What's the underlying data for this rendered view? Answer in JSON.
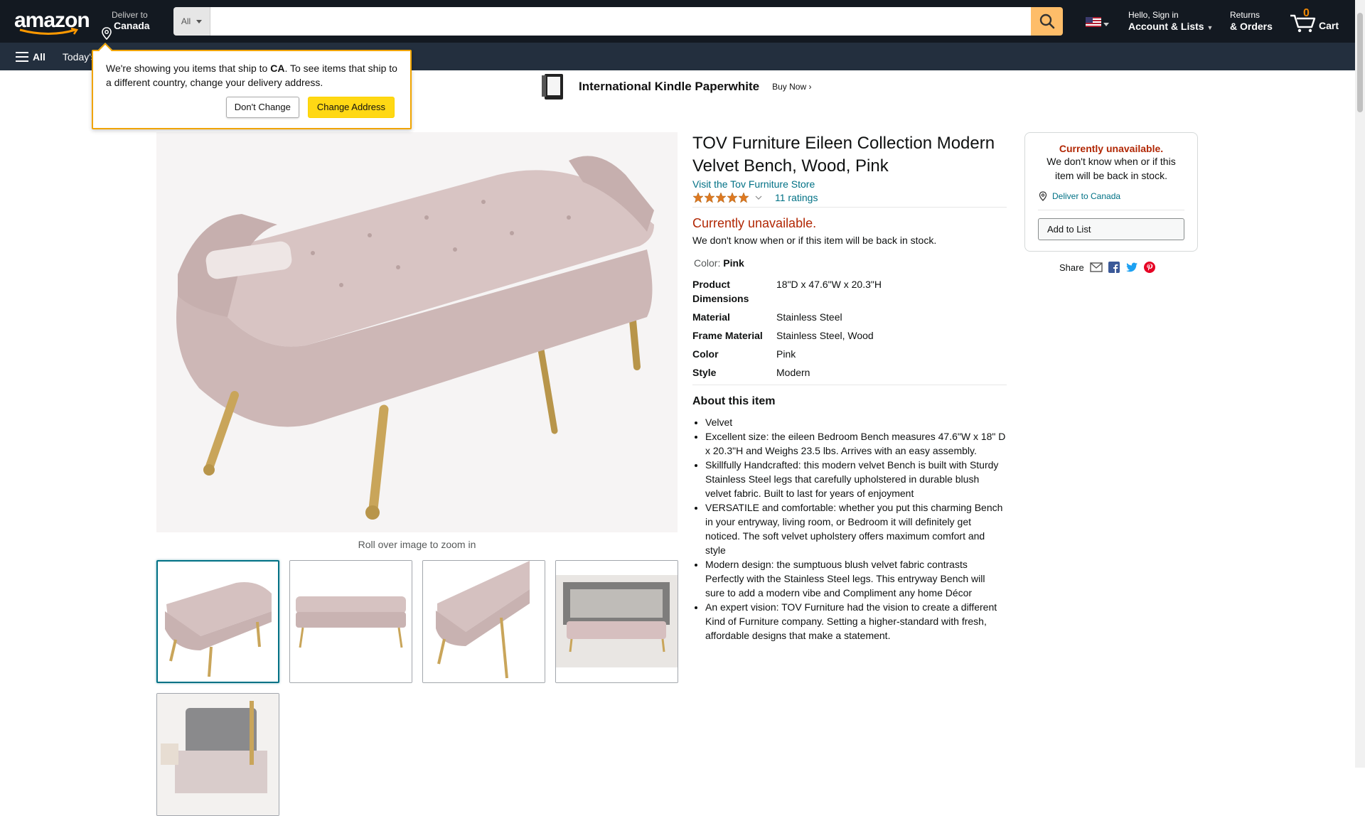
{
  "header": {
    "logo_text": "amazon",
    "deliver_line1": "Deliver to",
    "deliver_line2": "Canada",
    "search_category": "All",
    "search_placeholder": "",
    "signin_line1": "Hello, Sign in",
    "signin_line2": "Account & Lists",
    "returns_line1": "Returns",
    "returns_line2": "& Orders",
    "cart_count": "0",
    "cart_label": "Cart"
  },
  "nav": {
    "all_label": "All",
    "today_label": "Today's"
  },
  "popover": {
    "text_before": "We're showing you items that ship to ",
    "country": "CA",
    "text_after": ". To see items that ship to a different country, change your delivery address.",
    "dont_change": "Don't Change",
    "change_address": "Change Address"
  },
  "banner": {
    "title": "International Kindle Paperwhite",
    "cta": "Buy Now ›"
  },
  "product": {
    "title": "TOV Furniture Eileen Collection Modern Velvet Bench, Wood, Pink",
    "store_link": "Visit the Tov Furniture Store",
    "rating_stars": 5,
    "ratings_count": "11 ratings",
    "unavailable": "Currently unavailable.",
    "unavailable_sub": "We don't know when or if this item will be back in stock.",
    "color_label": "Color:",
    "color_value": "Pink",
    "zoom_note": "Roll over image to zoom in",
    "specs": [
      {
        "k": "Product Dimensions",
        "v": "18\"D x 47.6\"W x 20.3\"H"
      },
      {
        "k": "Material",
        "v": "Stainless Steel"
      },
      {
        "k": "Frame Material",
        "v": "Stainless Steel, Wood"
      },
      {
        "k": "Color",
        "v": "Pink"
      },
      {
        "k": "Style",
        "v": "Modern"
      }
    ],
    "about_heading": "About this item",
    "about": [
      "Velvet",
      "Excellent size: the eileen Bedroom Bench measures 47.6\"W x 18\" D x 20.3\"H and Weighs 23.5 lbs. Arrives with an easy assembly.",
      "Skillfully Handcrafted: this modern velvet Bench is built with Sturdy Stainless Steel legs that carefully upholstered in durable blush velvet fabric. Built to last for years of enjoyment",
      "VERSATILE and comfortable: whether you put this charming Bench in your entryway, living room, or Bedroom it will definitely get noticed. The soft velvet upholstery offers maximum comfort and style",
      "Modern design: the sumptuous blush velvet fabric contrasts Perfectly with the Stainless Steel legs. This entryway Bench will sure to add a modern vibe and Compliment any home Décor",
      "An expert vision: TOV Furniture had the vision to create a different Kind of Furniture company. Setting a higher-standard with fresh, affordable designs that make a statement."
    ]
  },
  "buybox": {
    "unavailable": "Currently unavailable.",
    "sub": "We don't know when or if this item will be back in stock.",
    "deliver": "Deliver to Canada",
    "add_to_list": "Add to List",
    "share_label": "Share"
  },
  "colors": {
    "topbar": "#131921",
    "navbar": "#232f3e",
    "search_button": "#febd69",
    "link": "#007185",
    "unavailable": "#b12704",
    "star": "#de7921"
  }
}
